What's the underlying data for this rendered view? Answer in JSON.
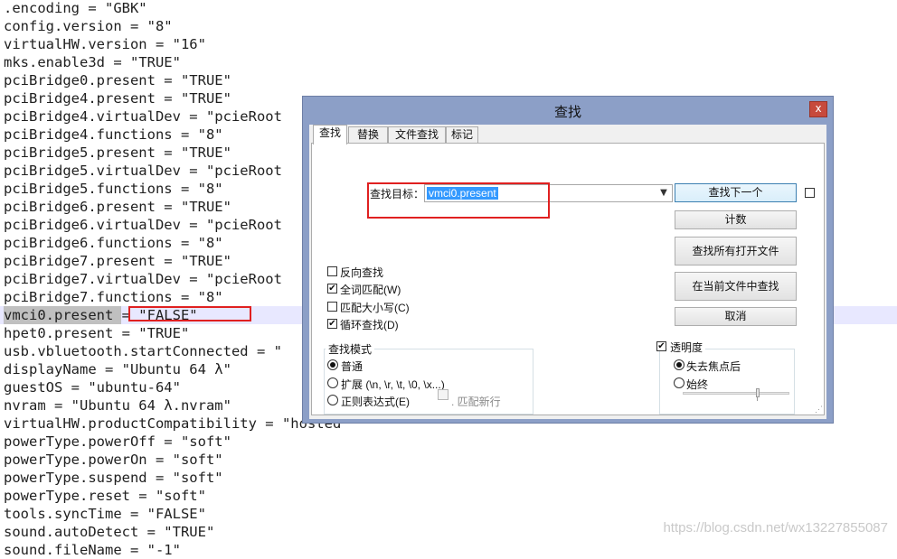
{
  "editor": {
    "lines": [
      ".encoding = \"GBK\"",
      "config.version = \"8\"",
      "virtualHW.version = \"16\"",
      "mks.enable3d = \"TRUE\"",
      "pciBridge0.present = \"TRUE\"",
      "pciBridge4.present = \"TRUE\"",
      "pciBridge4.virtualDev = \"pcieRoot",
      "pciBridge4.functions = \"8\"",
      "pciBridge5.present = \"TRUE\"",
      "pciBridge5.virtualDev = \"pcieRoot",
      "pciBridge5.functions = \"8\"",
      "pciBridge6.present = \"TRUE\"",
      "pciBridge6.virtualDev = \"pcieRoot",
      "pciBridge6.functions = \"8\"",
      "pciBridge7.present = \"TRUE\"",
      "pciBridge7.virtualDev = \"pcieRoot",
      "pciBridge7.functions = \"8\"",
      "vmci0.present = \"FALSE\"",
      "hpet0.present = \"TRUE\"",
      "usb.vbluetooth.startConnected = \"",
      "displayName = \"Ubuntu 64 λ\"",
      "guestOS = \"ubuntu-64\"",
      "nvram = \"Ubuntu 64 λ.nvram\"",
      "virtualHW.productCompatibility = \"hosted\"",
      "powerType.powerOff = \"soft\"",
      "powerType.powerOn = \"soft\"",
      "powerType.suspend = \"soft\"",
      "powerType.reset = \"soft\"",
      "tools.syncTime = \"FALSE\"",
      "sound.autoDetect = \"TRUE\"",
      "sound.fileName = \"-1\""
    ],
    "watermark": "https://blog.csdn.net/wx13227855087"
  },
  "dialog": {
    "title": "查找",
    "close_glyph": "x",
    "tabs": [
      "查找",
      "替换",
      "文件查找",
      "标记"
    ],
    "find_label": "查找目标：",
    "find_value": "vmci0.present",
    "buttons": {
      "find_next": "查找下一个",
      "count": "计数",
      "find_all_open": "查找所有打开文件",
      "find_in_current": "在当前文件中查找",
      "cancel": "取消"
    },
    "options": {
      "backward": "反向查找",
      "whole_word": "全词匹配(W)",
      "match_case": "匹配大小写(C)",
      "wrap": "循环查找(D)"
    },
    "search_mode": {
      "title": "查找模式",
      "normal": "普通",
      "extended": "扩展 (\\n, \\r, \\t, \\0, \\x...)",
      "regex": "正则表达式(E)",
      "dot_newline": ". 匹配新行"
    },
    "transparency": {
      "title": "透明度",
      "on_lose_focus": "失去焦点后",
      "always": "始终",
      "level": 0.7
    },
    "states": {
      "backward": false,
      "whole_word": true,
      "match_case": false,
      "wrap": true,
      "mode": "normal",
      "transparency_enabled": true,
      "transparency_mode": "on_lose_focus",
      "dot_newline": false,
      "extra_checkbox": false
    }
  },
  "colors": {
    "dialog_frame": "#8c9fc7",
    "annotation_red": "#e02020",
    "selection_blue": "#3399ff",
    "current_line": "#e8e8ff"
  }
}
